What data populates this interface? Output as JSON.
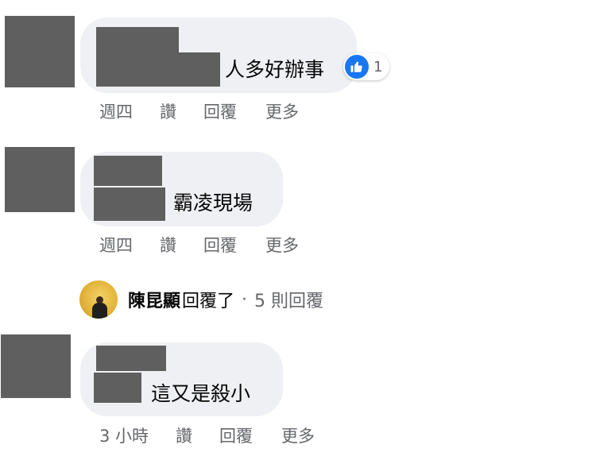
{
  "comments": [
    {
      "text": "人多好辦事",
      "reaction": {
        "icon": "thumbs-up-icon",
        "count": "1",
        "color": "#1877f2"
      },
      "actions": {
        "time": "週四",
        "like": "讚",
        "reply": "回覆",
        "more": "更多"
      }
    },
    {
      "text": "霸凌現場",
      "actions": {
        "time": "週四",
        "like": "讚",
        "reply": "回覆",
        "more": "更多"
      }
    },
    {
      "text": "這又是殺小",
      "actions": {
        "time": "3 小時",
        "like": "讚",
        "reply": "回覆",
        "more": "更多"
      }
    }
  ],
  "reply_summary": {
    "name": "陳昆顯",
    "action": "回覆了",
    "separator": "·",
    "count": "5 則回覆"
  },
  "colors": {
    "bubble": "#eff0f3",
    "redaction": "#5f5f5f",
    "meta_text": "#65676b",
    "like_blue": "#1877f2"
  }
}
